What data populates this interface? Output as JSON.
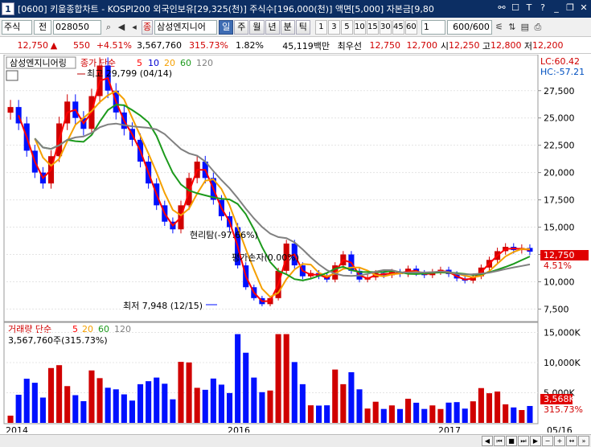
{
  "window": {
    "number": "1",
    "title": "[0600] 키움종합차트 - KOSPI200 외국인보유[29,325(천)] 주식수[196,000(천)] 액면[5,000] 자본금[9,80"
  },
  "toolbar": {
    "market": "주식",
    "mode": "전",
    "code": "028050",
    "stock_name": "삼성엔지니어",
    "periods": [
      "일",
      "주",
      "월",
      "년",
      "분",
      "틱"
    ],
    "active_period": "일",
    "intervals": [
      "1",
      "3",
      "5",
      "10",
      "15",
      "30",
      "45",
      "60"
    ],
    "unit_select": "1",
    "count": "600/600"
  },
  "price_bar": {
    "price": "12,750",
    "change_arrow": "▲",
    "change": "550",
    "change_pct": "+4.51%",
    "volume": "3,567,760",
    "volume_ratio": "315.73%",
    "turnover": "1.82%",
    "amount": "45,119백만",
    "pref_label": "최우선",
    "bid1": "12,750",
    "bid2": "12,700",
    "open_label": "시",
    "open": "12,250",
    "high_label": "고",
    "high": "12,800",
    "low_label": "저",
    "low": "12,200"
  },
  "price_panel": {
    "stock_label": "삼성엔지니어링",
    "ma_title": "종가 단순",
    "ma_periods": [
      "5",
      "10",
      "20",
      "60",
      "120"
    ],
    "lc": "LC:60.42",
    "hc": "HC:-57.21",
    "annot_high": "최고 29,799 (04/14)",
    "annot_low": "최저 7,948 (12/15)",
    "annot_return": "현리탐(-97.66%)",
    "annot_pnl": "평가손자(0.00%)",
    "current_price_tag": "12,750",
    "current_pct_tag": "4.51%",
    "y_ticks": [
      "27,500",
      "25,000",
      "22,500",
      "20,000",
      "17,500",
      "15,000",
      "12,500",
      "10,000",
      "7,500"
    ]
  },
  "volume_panel": {
    "title": "거래량 단순",
    "ma_periods": [
      "5",
      "20",
      "60",
      "120"
    ],
    "value_label": "3,567,760주(315.73%)",
    "y_ticks": [
      "15,000K",
      "10,000K",
      "5,000K"
    ],
    "current_tag": "3,568K",
    "current_pct": "315.73%"
  },
  "x_axis": {
    "labels": [
      "2014",
      "2016",
      "2017"
    ],
    "right_label": "05/16"
  },
  "colors": {
    "up": "#d00000",
    "down": "#0010ff",
    "ma5": "#ff0000",
    "ma10": "#0000d0",
    "ma20": "#f5a000",
    "ma60": "#1c9a1c",
    "ma120": "#808080",
    "title_bar": "#0c2e63"
  },
  "chart_data": {
    "type": "line",
    "title": "",
    "xlabel": "",
    "ylabel": "",
    "ylim": [
      6500,
      30500
    ],
    "series": [
      {
        "name": "종가",
        "values": [
          26000,
          24500,
          22000,
          20000,
          19000,
          21500,
          24500,
          26500,
          25000,
          24000,
          27000,
          29799,
          27500,
          25500,
          24000,
          23000,
          21000,
          19000,
          17000,
          15500,
          14800,
          17000,
          19500,
          21000,
          19500,
          17500,
          16000,
          15000,
          11500,
          9500,
          8500,
          7948,
          8500,
          11000,
          13500,
          11500,
          10500,
          10800,
          10500,
          10200,
          11500,
          12500,
          11000,
          10200,
          10400,
          10800,
          10600,
          10900,
          10700,
          11200,
          10800,
          10600,
          10900,
          11100,
          10700,
          10300,
          10100,
          10500,
          11300,
          12000,
          12800,
          13200,
          12900,
          13100,
          12750
        ]
      }
    ],
    "volume_ylim": [
      0,
      16000
    ],
    "volume_current": 3568
  }
}
